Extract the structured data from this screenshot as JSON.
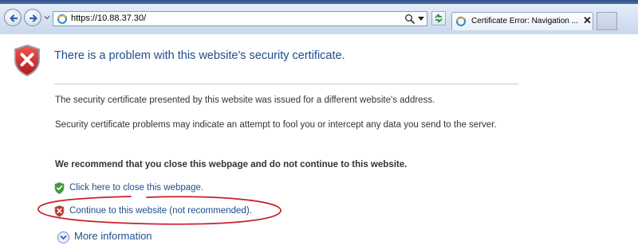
{
  "browser": {
    "address_url": "https://10.88.37.30/",
    "tab_title": "Certificate Error: Navigation ...",
    "tab_close": "✕"
  },
  "page": {
    "heading": "There is a problem with this website's security certificate.",
    "paragraph_1": "The security certificate presented by this website was issued for a different website's address.",
    "paragraph_2": "Security certificate problems may indicate an attempt to fool you or intercept any data you send to the server.",
    "recommendation": "We recommend that you close this webpage and do not continue to this website.",
    "close_link": "Click here to close this webpage.",
    "continue_link": "Continue to this website (not recommended).",
    "more_info_link": "More information"
  },
  "icons": {
    "heading_icon": "red-shield-x-icon",
    "close_link_icon": "green-shield-check-icon",
    "continue_link_icon": "red-shield-x-icon",
    "more_info_icon": "chevron-down-circle-icon"
  },
  "colors": {
    "link": "#1f4d8c",
    "body_text": "#333333",
    "annotation": "#c8202a",
    "chrome": "#d4e1f2"
  }
}
